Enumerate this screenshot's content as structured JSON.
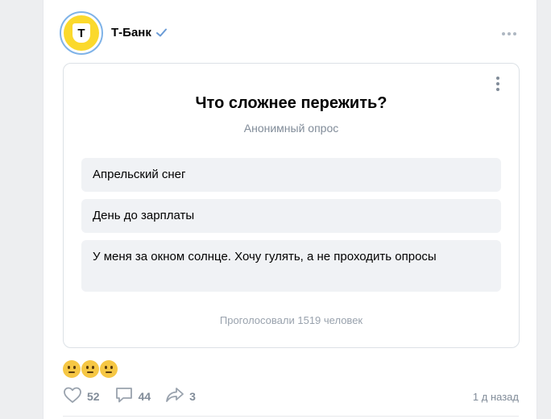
{
  "post": {
    "author": "Т-Банк",
    "logo_letter": "Т",
    "time": "1 д назад"
  },
  "poll": {
    "title": "Что сложнее пережить?",
    "subtitle": "Анонимный опрос",
    "options": [
      {
        "label": "Апрельский снег"
      },
      {
        "label": "День до зарплаты"
      },
      {
        "label": "У меня за окном солнце. Хочу гулять, а не проходить опросы"
      }
    ],
    "votes_label": "Проголосовали 1519 человек"
  },
  "footer": {
    "likes": "52",
    "comments": "44",
    "shares": "3"
  },
  "colors": {
    "brand_yellow": "#fbd92c",
    "verified_blue": "#6a9bd6",
    "muted": "#818c99"
  }
}
